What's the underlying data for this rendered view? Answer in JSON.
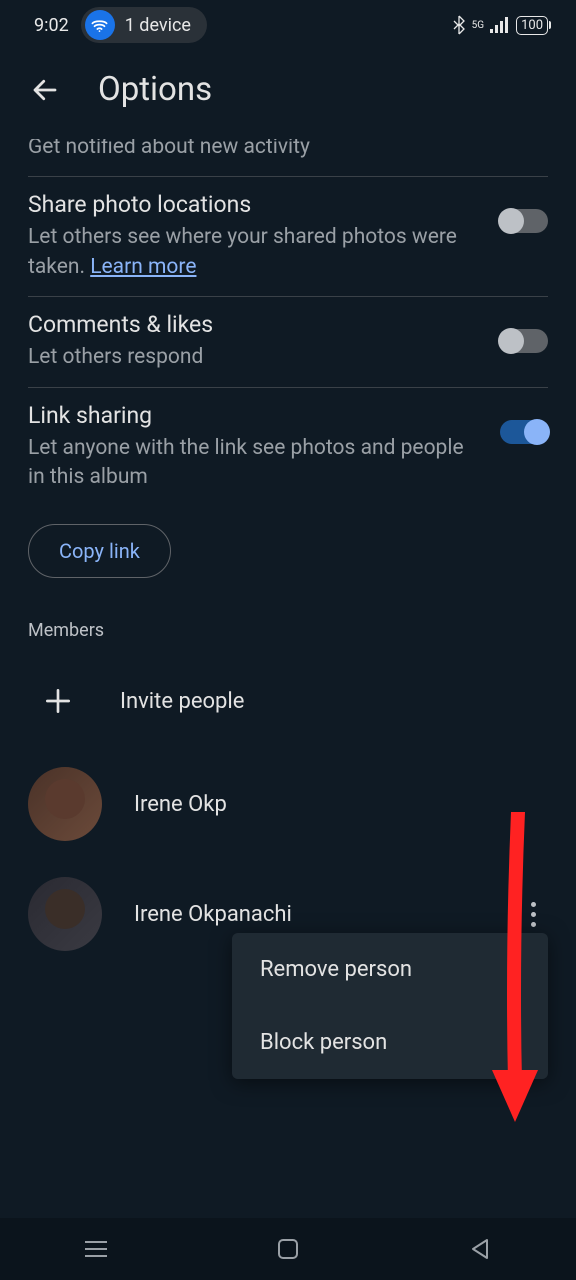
{
  "status": {
    "time": "9:02",
    "device_count": "1 device",
    "battery": "100",
    "signal": "5G"
  },
  "header": {
    "title": "Options"
  },
  "settings": {
    "notify": {
      "title": "Get notified about new activity"
    },
    "locations": {
      "title": "Share photo locations",
      "desc1": "Let others see where your shared photos were taken. ",
      "learn": "Learn more"
    },
    "comments": {
      "title": "Comments & likes",
      "desc": "Let others respond"
    },
    "link": {
      "title": "Link sharing",
      "desc": "Let anyone with the link see photos and people in this album"
    },
    "copy_link": "Copy link"
  },
  "members": {
    "section_title": "Members",
    "invite_label": "Invite people",
    "list": [
      {
        "name": "Irene Okp"
      },
      {
        "name": "Irene Okpanachi"
      }
    ]
  },
  "popup": {
    "remove": "Remove person",
    "block": "Block person"
  }
}
